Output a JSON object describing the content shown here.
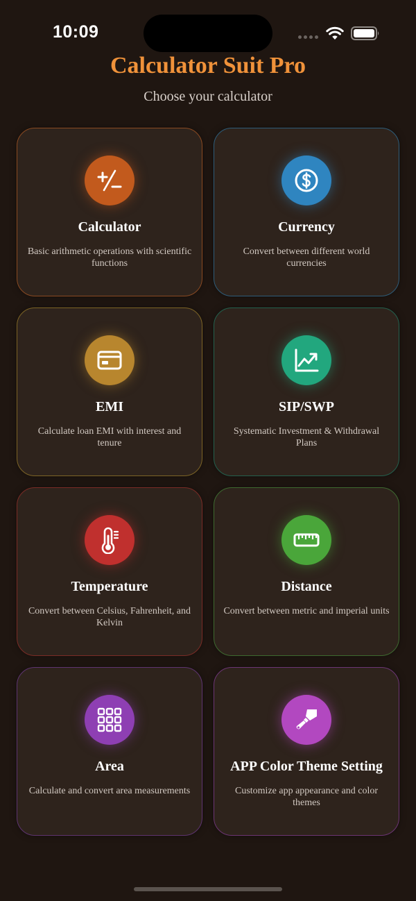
{
  "status_bar": {
    "time": "10:09"
  },
  "header": {
    "title": "Calculator Suit Pro",
    "subtitle": "Choose your calculator"
  },
  "cards": [
    {
      "title": "Calculator",
      "description": "Basic arithmetic operations with scientific functions",
      "icon": "plus-minus-icon",
      "accent": "#c25a1d",
      "border": "#8a4a22"
    },
    {
      "title": "Currency",
      "description": "Convert between different world currencies",
      "icon": "dollar-icon",
      "accent": "#2f85c0",
      "border": "#2e5d7a"
    },
    {
      "title": "EMI",
      "description": "Calculate loan EMI with interest and tenure",
      "icon": "credit-card-icon",
      "accent": "#b8862e",
      "border": "#7d6426"
    },
    {
      "title": "SIP/SWP",
      "description": "Systematic Investment & Withdrawal Plans",
      "icon": "chart-line-up-icon",
      "accent": "#22a77e",
      "border": "#23614e"
    },
    {
      "title": "Temperature",
      "description": "Convert between Celsius, Fahrenheit, and Kelvin",
      "icon": "thermometer-icon",
      "accent": "#c0302e",
      "border": "#7a2c26"
    },
    {
      "title": "Distance",
      "description": "Convert between metric and imperial units",
      "icon": "ruler-icon",
      "accent": "#4aa63a",
      "border": "#3e6a30"
    },
    {
      "title": "Area",
      "description": "Calculate and convert area measurements",
      "icon": "grid-icon",
      "accent": "#8e3fb3",
      "border": "#5e3470"
    },
    {
      "title": "APP Color Theme Setting",
      "description": "Customize app appearance and color themes",
      "icon": "paintbrush-icon",
      "accent": "#b248c0",
      "border": "#6c3574"
    }
  ]
}
